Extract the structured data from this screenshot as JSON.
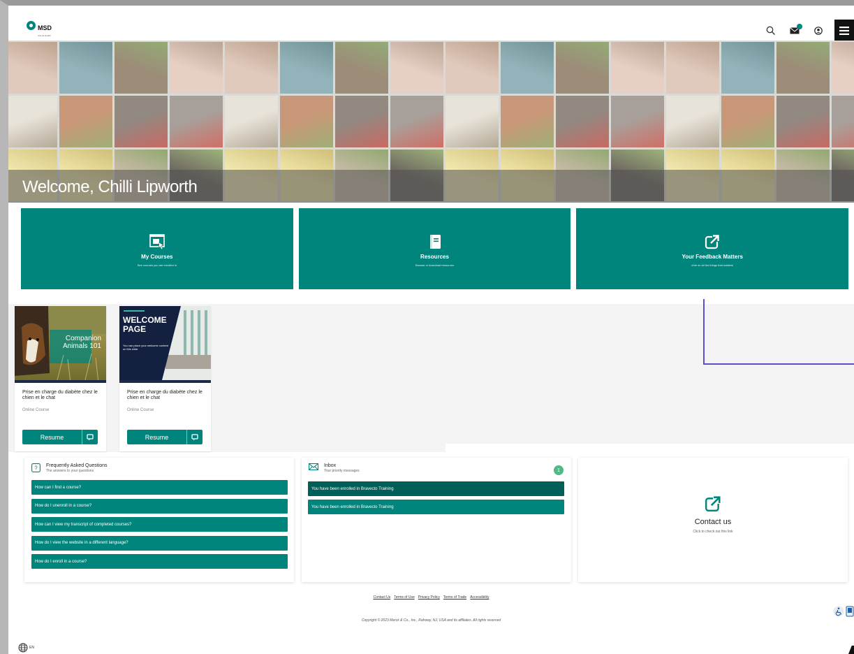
{
  "header": {
    "logo_text": "MSD",
    "logo_sub": "Animal Health",
    "icons": [
      "search-icon",
      "mail-icon",
      "user-icon",
      "menu-icon"
    ],
    "mail_badge": "1"
  },
  "hero": {
    "welcome": "Welcome, Chilli Lipworth"
  },
  "tiles": [
    {
      "icon": "courses-icon",
      "title": "My Courses",
      "subtitle": "See courses you are enrolled in"
    },
    {
      "icon": "book-icon",
      "title": "Resources",
      "subtitle": "Browse or download resources"
    },
    {
      "icon": "external-link-icon",
      "title": "Your Feedback Matters",
      "subtitle": "Vote on all the things that matters!"
    }
  ],
  "courses": [
    {
      "image_text": "Companion Animals 101",
      "title": "Prise en charge du diabète chez le chien et le chat",
      "type": "Online Course",
      "button": "Resume"
    },
    {
      "image_text": "WELCOME PAGE",
      "image_sub": "You can place your welcome content on this slide.",
      "title": "Prise en charge du diabète chez le chien et le chat",
      "type": "Online Course",
      "button": "Resume"
    }
  ],
  "faq": {
    "title": "Frequently Asked Questions",
    "subtitle": "The answers to your questions",
    "items": [
      "How can I find a course?",
      "How do I unenroll in a course?",
      "How can I view my transcript of completed courses?",
      "How do I view the website in a different language?",
      "How do I enroll in a course?"
    ]
  },
  "inbox": {
    "title": "Inbox",
    "subtitle": "Your priority messages",
    "count": "1",
    "messages": [
      "You have been enrolled in Bravecto Training",
      "You have been enrolled in Bravecto Training"
    ]
  },
  "contact": {
    "title": "Contact us",
    "subtitle": "Click to check out this link"
  },
  "footer": {
    "links": [
      "Contact Us",
      "Terms of Use",
      "Privacy Policy",
      "Terms of Trade",
      "Accessibility"
    ],
    "copyright": "Copyright © 2023 Merck & Co., Inc., Rahway, NJ, USA and its affiliates. All rights reserved",
    "language": "EN"
  },
  "colors": {
    "primary": "#00857c",
    "primary_dark": "#005f58",
    "navy": "#1d2a4a",
    "annotation": "#5a4fcf"
  }
}
